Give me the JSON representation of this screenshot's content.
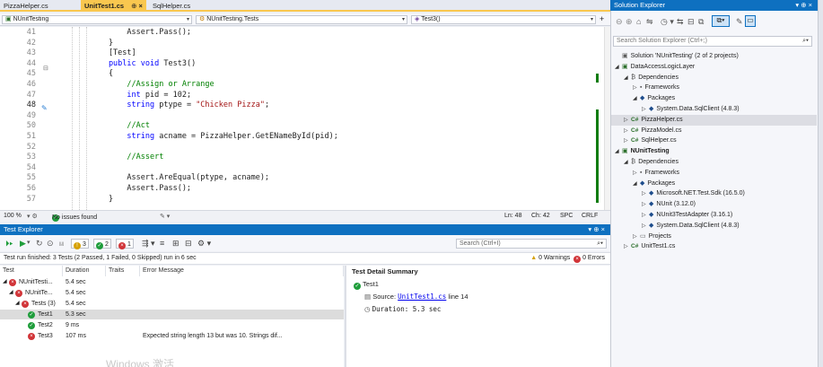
{
  "editor_tabs": [
    {
      "label": "PizzaHelper.cs"
    },
    {
      "label": "UnitTest1.cs",
      "pin": "⊕",
      "close": "×"
    },
    {
      "label": "SqlHelper.cs"
    }
  ],
  "navbar": {
    "project": "NUnitTesting",
    "class": "NUnitTesting.Tests",
    "member": "Test3()"
  },
  "code_lines": [
    {
      "n": "41",
      "parts": [
        [
          "",
          "            Assert.Pass();"
        ]
      ]
    },
    {
      "n": "42",
      "parts": [
        [
          "",
          "        }"
        ]
      ]
    },
    {
      "n": "43",
      "parts": [
        [
          "",
          "        [Test]"
        ]
      ]
    },
    {
      "n": "44",
      "parts": [
        [
          "kw",
          "        public void "
        ],
        [
          "",
          "Test3()"
        ]
      ]
    },
    {
      "n": "45",
      "parts": [
        [
          "",
          "        {"
        ]
      ]
    },
    {
      "n": "46",
      "parts": [
        [
          "cm",
          "            //Assign or Arrange"
        ]
      ]
    },
    {
      "n": "47",
      "parts": [
        [
          "kw",
          "            int "
        ],
        [
          "",
          "pid = 102;"
        ]
      ]
    },
    {
      "n": "48",
      "parts": [
        [
          "kw",
          "            string "
        ],
        [
          "",
          "ptype = "
        ],
        [
          "st",
          "\"Chicken Pizza\""
        ],
        [
          "",
          ";"
        ]
      ]
    },
    {
      "n": "49",
      "parts": [
        [
          "",
          ""
        ]
      ]
    },
    {
      "n": "50",
      "parts": [
        [
          "cm",
          "            //Act"
        ]
      ]
    },
    {
      "n": "51",
      "parts": [
        [
          "kw",
          "            string "
        ],
        [
          "",
          "acname = PizzaHelper.GetENameById(pid);"
        ]
      ]
    },
    {
      "n": "52",
      "parts": [
        [
          "",
          ""
        ]
      ]
    },
    {
      "n": "53",
      "parts": [
        [
          "cm",
          "            //Assert"
        ]
      ]
    },
    {
      "n": "54",
      "parts": [
        [
          "",
          ""
        ]
      ]
    },
    {
      "n": "55",
      "parts": [
        [
          "",
          "            Assert.AreEqual(ptype, acname);"
        ]
      ]
    },
    {
      "n": "56",
      "parts": [
        [
          "",
          "            Assert.Pass();"
        ]
      ]
    },
    {
      "n": "57",
      "parts": [
        [
          "",
          "        }"
        ]
      ]
    }
  ],
  "editor_status": {
    "zoom": "100 %",
    "issues": "No issues found",
    "ln": "Ln: 48",
    "ch": "Ch: 42",
    "spc": "SPC",
    "crlf": "CRLF"
  },
  "test_explorer": {
    "title": "Test Explorer",
    "title_controls": "▾ ⊕ ×",
    "badges": {
      "total": "3",
      "passed": "2",
      "failed": "1"
    },
    "search_placeholder": "Search (Ctrl+I)",
    "summary": "Test run finished: 3 Tests (2 Passed, 1 Failed, 0 Skipped) run in 6 sec",
    "warnings": "0 Warnings",
    "errors": "0 Errors",
    "columns": [
      "Test",
      "Duration",
      "Traits",
      "Error Message"
    ],
    "rows": [
      {
        "indent": 0,
        "expander": "◢",
        "status": "failed",
        "name": "NUnitTesti...",
        "duration": "5.4 sec",
        "error": ""
      },
      {
        "indent": 1,
        "expander": "◢",
        "status": "failed",
        "name": "NUnitTe...",
        "duration": "5.4 sec",
        "error": ""
      },
      {
        "indent": 2,
        "expander": "◢",
        "status": "failed",
        "name": "Tests (3)",
        "duration": "5.4 sec",
        "error": ""
      },
      {
        "indent": 3,
        "expander": "",
        "status": "passed",
        "name": "Test1",
        "duration": "5.3 sec",
        "error": ""
      },
      {
        "indent": 3,
        "expander": "",
        "status": "passed",
        "name": "Test2",
        "duration": "9 ms",
        "error": ""
      },
      {
        "indent": 3,
        "expander": "",
        "status": "failed",
        "name": "Test3",
        "duration": "107 ms",
        "error": "Expected string length 13 but was 10. Strings dif..."
      }
    ],
    "detail": {
      "heading": "Test Detail Summary",
      "test_name": "Test1",
      "source_label": "Source:",
      "source_link": "UnitTest1.cs",
      "source_line": "line 14",
      "duration_label": "Duration: 5.3 sec"
    },
    "watermark": "Windows 激活"
  },
  "solution_explorer": {
    "title": "Solution Explorer",
    "title_controls": "▾ ⊕ ×",
    "search_placeholder": "Search Solution Explorer (Ctrl+;)",
    "items": [
      {
        "level": 0,
        "tri": "",
        "icon": "solution-icon",
        "glyph": "▣",
        "label": "Solution 'NUnitTesting' (2 of 2 projects)"
      },
      {
        "level": 0,
        "tri": "◢",
        "icon": "project-icon",
        "glyph": "▣",
        "label": "DataAccessLogicLayer",
        "bold": false
      },
      {
        "level": 1,
        "tri": "◢",
        "icon": "dependencies-icon",
        "glyph": "₿",
        "label": "Dependencies"
      },
      {
        "level": 2,
        "tri": "▷",
        "icon": "frameworks-icon",
        "glyph": "▪",
        "label": "Frameworks"
      },
      {
        "level": 2,
        "tri": "◢",
        "icon": "packages-icon",
        "glyph": "◆",
        "label": "Packages"
      },
      {
        "level": 3,
        "tri": "▷",
        "icon": "package-icon",
        "glyph": "◆",
        "label": "System.Data.SqlClient (4.8.3)"
      },
      {
        "level": 1,
        "tri": "▷",
        "icon": "csharp-file-icon",
        "glyph": "C#",
        "label": "PizzaHelper.cs",
        "sel": true
      },
      {
        "level": 1,
        "tri": "▷",
        "icon": "csharp-file-icon",
        "glyph": "C#",
        "label": "PizzaModel.cs"
      },
      {
        "level": 1,
        "tri": "▷",
        "icon": "csharp-file-icon",
        "glyph": "C#",
        "label": "SqlHelper.cs"
      },
      {
        "level": 0,
        "tri": "◢",
        "icon": "test-project-icon",
        "glyph": "▣",
        "label": "NUnitTesting",
        "bold": true
      },
      {
        "level": 1,
        "tri": "◢",
        "icon": "dependencies-icon",
        "glyph": "₿",
        "label": "Dependencies"
      },
      {
        "level": 2,
        "tri": "▷",
        "icon": "frameworks-icon",
        "glyph": "▪",
        "label": "Frameworks"
      },
      {
        "level": 2,
        "tri": "◢",
        "icon": "packages-icon",
        "glyph": "◆",
        "label": "Packages"
      },
      {
        "level": 3,
        "tri": "▷",
        "icon": "package-icon",
        "glyph": "◆",
        "label": "Microsoft.NET.Test.Sdk (16.5.0)"
      },
      {
        "level": 3,
        "tri": "▷",
        "icon": "package-icon",
        "glyph": "◆",
        "label": "NUnit (3.12.0)"
      },
      {
        "level": 3,
        "tri": "▷",
        "icon": "package-icon",
        "glyph": "◆",
        "label": "NUnit3TestAdapter (3.16.1)"
      },
      {
        "level": 3,
        "tri": "▷",
        "icon": "package-icon",
        "glyph": "◆",
        "label": "System.Data.SqlClient (4.8.3)"
      },
      {
        "level": 2,
        "tri": "▷",
        "icon": "folder-icon",
        "glyph": "▭",
        "label": "Projects"
      },
      {
        "level": 1,
        "tri": "▷",
        "icon": "csharp-file-icon",
        "glyph": "C#",
        "label": "UnitTest1.cs"
      }
    ]
  },
  "colors": {
    "accent": "#0e70c0",
    "active_tab": "#f9c74f",
    "passed": "#1f9d3b",
    "failed": "#d13438",
    "change_bar": "#107c10"
  }
}
